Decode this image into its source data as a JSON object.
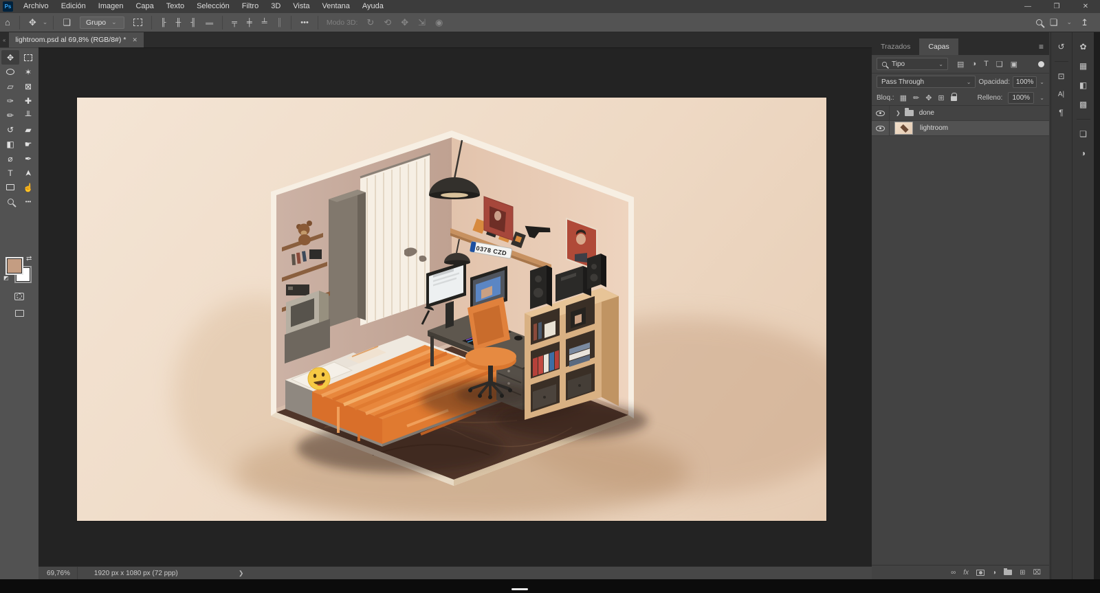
{
  "menubar": {
    "logo": "Ps",
    "items": [
      "Archivo",
      "Edición",
      "Imagen",
      "Capa",
      "Texto",
      "Selección",
      "Filtro",
      "3D",
      "Vista",
      "Ventana",
      "Ayuda"
    ]
  },
  "window_controls": {
    "minimize": "—",
    "restore": "❒",
    "close": "✕"
  },
  "options_bar": {
    "group_label": "Grupo",
    "mode3d_label": "Modo 3D:",
    "more_label": "•••"
  },
  "icons": {
    "home": "⌂",
    "move": "✥",
    "chevron_down": "⌄",
    "autoselect": "❏",
    "align_left": "╟",
    "align_hcenter": "╫",
    "align_right": "╢",
    "dist_center": "▬",
    "align_top": "╤",
    "align_vmiddle": "╪",
    "align_bottom": "╧",
    "dist_vertical": "║",
    "orbit3d": "↻",
    "roll3d": "⟲",
    "pan3d": "✥",
    "slide3d": "⇲",
    "camera3d": "◉",
    "share": "↥",
    "wand": "✶",
    "crop_persp": "▱",
    "frame": "⊠",
    "eyedropper": "✑",
    "healing": "✚",
    "brush": "✏",
    "stamp": "╨",
    "history_brush": "↺",
    "eraser": "▰",
    "gradient": "◧",
    "smudge": "☛",
    "dodge": "⌀",
    "pen": "✒",
    "type": "T",
    "path_select": "➤",
    "hand": "☝",
    "more": "•••",
    "swap": "⇄",
    "mini_swatches": "◩",
    "filter_image": "▤",
    "filter_adjust": "◑",
    "filter_type": "T",
    "filter_shape": "❑",
    "filter_smart": "▣",
    "lock_transparent": "▦",
    "lock_paint": "✏",
    "lock_move": "✥",
    "lock_artboard": "⊞",
    "group_expand": "❯",
    "panel_menu": "≡",
    "dock_history": "↺",
    "dock_properties": "⊡",
    "dock_character": "A|",
    "dock_paragraph": "¶",
    "dock_color": "✿",
    "dock_swatches": "▦",
    "dock_gradients": "◧",
    "dock_patterns": "▩",
    "dock_libraries": "❏",
    "dock_adjustments": "◑",
    "foot_link": "∞",
    "foot_fx": "fx",
    "foot_adjust": "◑",
    "foot_newlayer": "⊞",
    "foot_delete": "⌧",
    "collapse": "‹‹"
  },
  "document_tab": {
    "title": "lightroom.psd al 69,8% (RGB/8#) *",
    "close": "✕"
  },
  "toolbar": {
    "foreground_color": "#c49d82",
    "background_color": "#ffffff"
  },
  "panels": {
    "tab_trazados": "Trazados",
    "tab_capas": "Capas",
    "filter_label": "Tipo",
    "blend_mode": "Pass Through",
    "opacity_label": "Opacidad:",
    "opacity_value": "100%",
    "lock_label": "Bloq.:",
    "fill_label": "Relleno:",
    "fill_value": "100%",
    "layers": [
      {
        "name": "done",
        "type": "group",
        "visible": true
      },
      {
        "name": "lightroom",
        "type": "image",
        "visible": true,
        "selected": true
      }
    ]
  },
  "status_bar": {
    "zoom": "69,76%",
    "dimensions": "1920 px x 1080 px (72 ppp)",
    "chevron": "❯"
  },
  "canvas": {
    "license_plate": "0378 CZD"
  },
  "colors": {
    "fg_swatch": "#c49d82",
    "pasteboard": "#232323",
    "canvas_bg": "#eedcca",
    "duvet_orange": "#e8873c",
    "wall_left": "#c8aea1",
    "wall_right": "#e9cdb8",
    "floor_brown": "#50362a"
  }
}
